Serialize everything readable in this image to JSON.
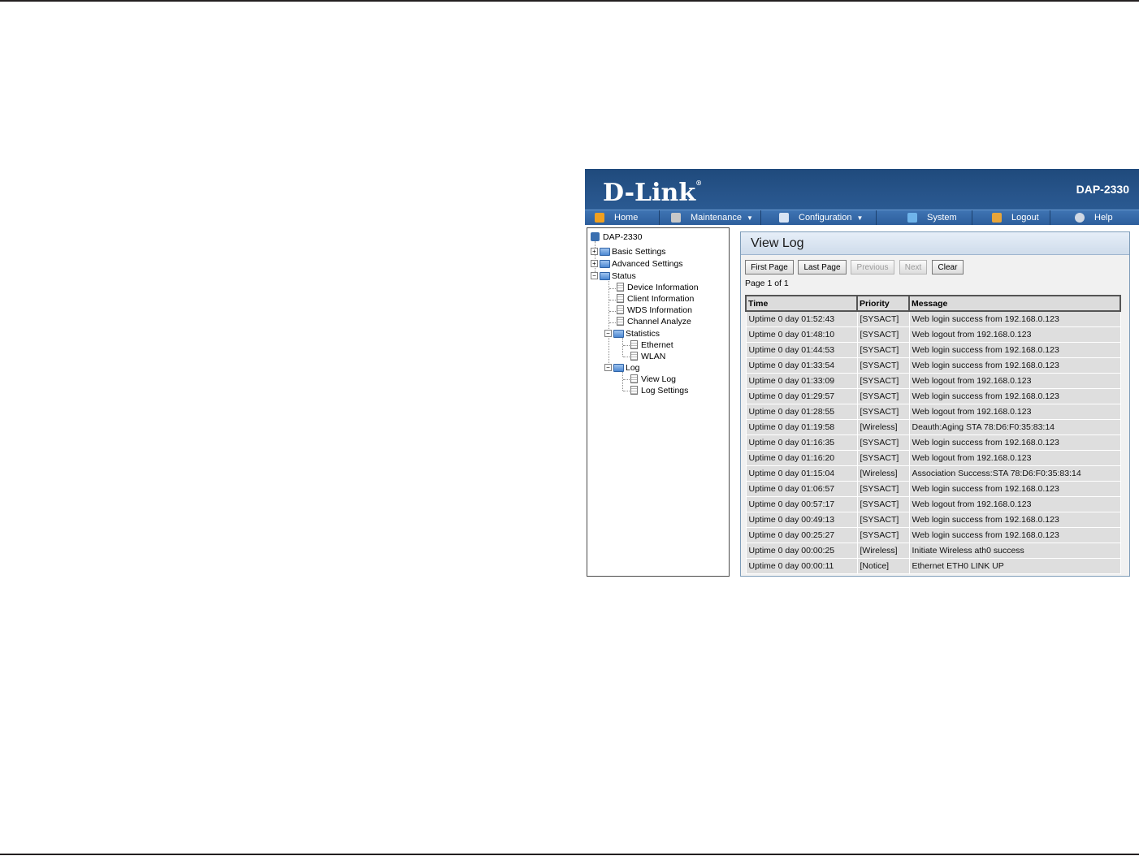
{
  "header": {
    "logo": "D-Link",
    "model": "DAP-2330"
  },
  "menu": [
    {
      "label": "Home",
      "icon": "home-icon",
      "has_dropdown": false
    },
    {
      "label": "Maintenance",
      "icon": "tools-icon",
      "has_dropdown": true
    },
    {
      "label": "Configuration",
      "icon": "save-icon",
      "has_dropdown": true
    },
    {
      "label": "System",
      "icon": "system-icon",
      "has_dropdown": false
    },
    {
      "label": "Logout",
      "icon": "logout-icon",
      "has_dropdown": false
    },
    {
      "label": "Help",
      "icon": "help-icon",
      "has_dropdown": false
    }
  ],
  "tree": {
    "root": "DAP-2330",
    "basic_settings": "Basic Settings",
    "advanced_settings": "Advanced Settings",
    "status": "Status",
    "device_information": "Device Information",
    "client_information": "Client Information",
    "wds_information": "WDS Information",
    "channel_analyze": "Channel Analyze",
    "statistics": "Statistics",
    "ethernet": "Ethernet",
    "wlan": "WLAN",
    "log": "Log",
    "view_log": "View Log",
    "log_settings": "Log Settings"
  },
  "panel": {
    "title": "View Log",
    "buttons": {
      "first_page": "First Page",
      "last_page": "Last Page",
      "previous": "Previous",
      "next": "Next",
      "clear": "Clear"
    },
    "page_info": "Page 1 of 1"
  },
  "log_table": {
    "headers": {
      "time": "Time",
      "priority": "Priority",
      "message": "Message"
    },
    "rows": [
      {
        "time": "Uptime 0 day 01:52:43",
        "priority": "[SYSACT]",
        "message": "Web login success from 192.168.0.123"
      },
      {
        "time": "Uptime 0 day 01:48:10",
        "priority": "[SYSACT]",
        "message": "Web logout from 192.168.0.123"
      },
      {
        "time": "Uptime 0 day 01:44:53",
        "priority": "[SYSACT]",
        "message": "Web login success from 192.168.0.123"
      },
      {
        "time": "Uptime 0 day 01:33:54",
        "priority": "[SYSACT]",
        "message": "Web login success from 192.168.0.123"
      },
      {
        "time": "Uptime 0 day 01:33:09",
        "priority": "[SYSACT]",
        "message": "Web logout from 192.168.0.123"
      },
      {
        "time": "Uptime 0 day 01:29:57",
        "priority": "[SYSACT]",
        "message": "Web login success from 192.168.0.123"
      },
      {
        "time": "Uptime 0 day 01:28:55",
        "priority": "[SYSACT]",
        "message": "Web logout from 192.168.0.123"
      },
      {
        "time": "Uptime 0 day 01:19:58",
        "priority": "[Wireless]",
        "message": "Deauth:Aging STA 78:D6:F0:35:83:14"
      },
      {
        "time": "Uptime 0 day 01:16:35",
        "priority": "[SYSACT]",
        "message": "Web login success from 192.168.0.123"
      },
      {
        "time": "Uptime 0 day 01:16:20",
        "priority": "[SYSACT]",
        "message": "Web logout from 192.168.0.123"
      },
      {
        "time": "Uptime 0 day 01:15:04",
        "priority": "[Wireless]",
        "message": "Association Success:STA 78:D6:F0:35:83:14"
      },
      {
        "time": "Uptime 0 day 01:06:57",
        "priority": "[SYSACT]",
        "message": "Web login success from 192.168.0.123"
      },
      {
        "time": "Uptime 0 day 00:57:17",
        "priority": "[SYSACT]",
        "message": "Web logout from 192.168.0.123"
      },
      {
        "time": "Uptime 0 day 00:49:13",
        "priority": "[SYSACT]",
        "message": "Web login success from 192.168.0.123"
      },
      {
        "time": "Uptime 0 day 00:25:27",
        "priority": "[SYSACT]",
        "message": "Web login success from 192.168.0.123"
      },
      {
        "time": "Uptime 0 day 00:00:25",
        "priority": "[Wireless]",
        "message": "Initiate Wireless ath0 success"
      },
      {
        "time": "Uptime 0 day 00:00:11",
        "priority": "[Notice]",
        "message": "Ethernet ETH0 LINK UP"
      }
    ]
  },
  "colors": {
    "banner": "#27548a",
    "menubar": "#2d5e9c",
    "row_background": "#dedede"
  }
}
